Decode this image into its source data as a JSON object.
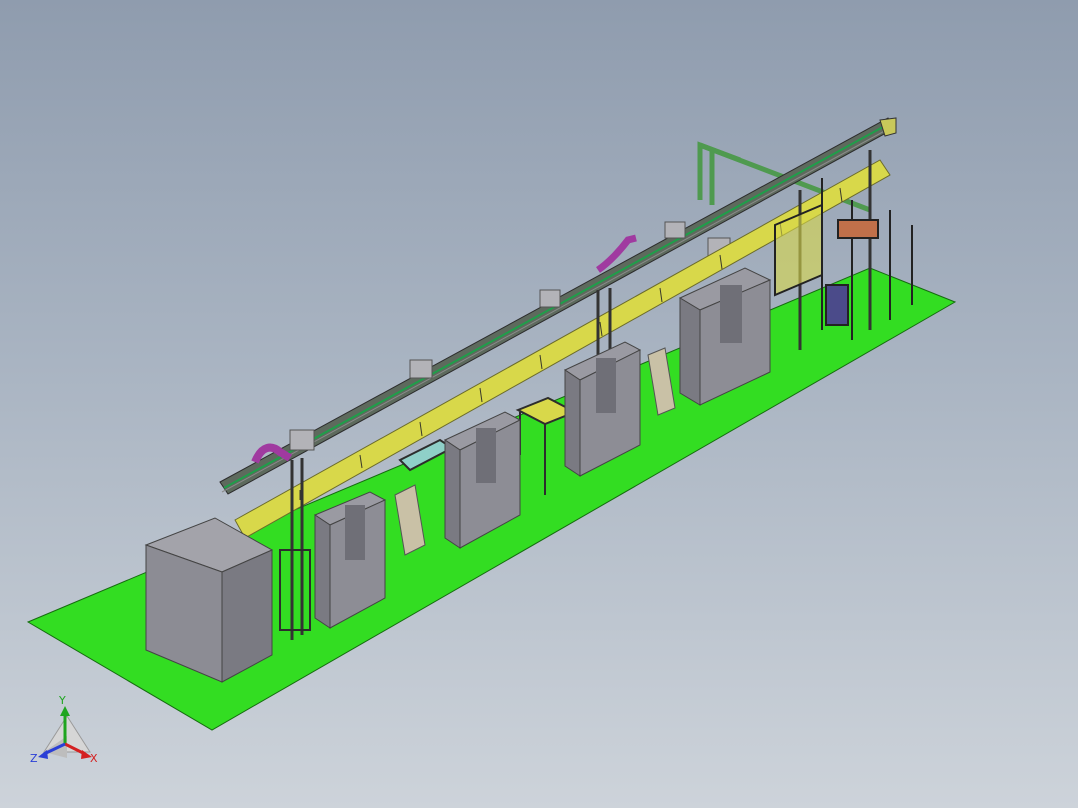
{
  "viewport": {
    "background_top": "#8f9cae",
    "background_bottom": "#cdd3da"
  },
  "model": {
    "floor_color": "#33dd22",
    "machine_color": "#8d8d95",
    "beam_color": "#d8d84a",
    "rail_color": "#4d5a4d",
    "duct_color": "#a03aa0"
  },
  "triad": {
    "x_label": "X",
    "y_label": "Y",
    "z_label": "Z",
    "x_color": "#d42020",
    "y_color": "#1fa51f",
    "z_color": "#2a3fd6"
  }
}
